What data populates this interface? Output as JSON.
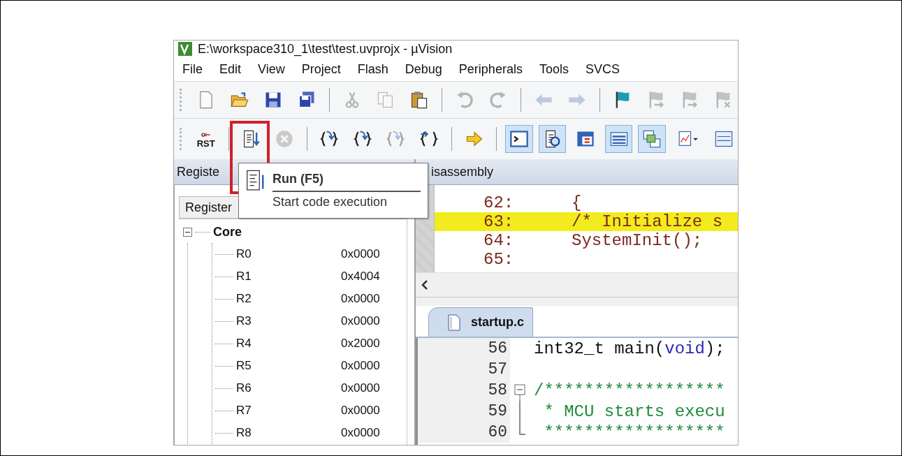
{
  "window": {
    "title": "E:\\workspace310_1\\test\\test.uvprojx - µVision"
  },
  "menu": [
    "File",
    "Edit",
    "View",
    "Project",
    "Flash",
    "Debug",
    "Peripherals",
    "Tools",
    "SVCS"
  ],
  "toolbar_file": [
    {
      "kind": "button",
      "disabled": false
    },
    {
      "kind": "button",
      "disabled": false
    },
    {
      "kind": "button",
      "disabled": false
    },
    {
      "kind": "button",
      "disabled": false
    },
    {
      "kind": "separator"
    },
    {
      "kind": "button",
      "disabled": true
    },
    {
      "kind": "button",
      "disabled": true
    },
    {
      "kind": "button",
      "disabled": false
    },
    {
      "kind": "separator"
    },
    {
      "kind": "button",
      "disabled": true
    },
    {
      "kind": "button",
      "disabled": true
    },
    {
      "kind": "separator"
    },
    {
      "kind": "button",
      "disabled": true
    },
    {
      "kind": "button",
      "disabled": true
    },
    {
      "kind": "separator"
    },
    {
      "kind": "button",
      "disabled": false
    },
    {
      "kind": "button",
      "disabled": true
    },
    {
      "kind": "button",
      "disabled": true
    },
    {
      "kind": "button",
      "disabled": true
    }
  ],
  "toolbar_debug": [
    {
      "kind": "text_button",
      "label": "RST",
      "disabled": false,
      "selected": false
    },
    {
      "kind": "separator"
    },
    {
      "kind": "button",
      "disabled": false,
      "selected": false
    },
    {
      "kind": "button",
      "disabled": true,
      "selected": false
    },
    {
      "kind": "separator"
    },
    {
      "kind": "button",
      "disabled": false,
      "selected": false
    },
    {
      "kind": "button",
      "disabled": false,
      "selected": false
    },
    {
      "kind": "button",
      "disabled": true,
      "selected": false
    },
    {
      "kind": "button",
      "disabled": false,
      "selected": false
    },
    {
      "kind": "separator"
    },
    {
      "kind": "button",
      "disabled": false,
      "selected": false
    },
    {
      "kind": "separator"
    },
    {
      "kind": "button",
      "disabled": false,
      "selected": true
    },
    {
      "kind": "button",
      "disabled": false,
      "selected": true
    },
    {
      "kind": "button",
      "disabled": false,
      "selected": false
    },
    {
      "kind": "button",
      "disabled": false,
      "selected": true
    },
    {
      "kind": "button",
      "disabled": false,
      "selected": true
    },
    {
      "kind": "button",
      "disabled": false,
      "selected": false
    },
    {
      "kind": "button",
      "disabled": false,
      "selected": false
    }
  ],
  "tooltip": {
    "title": "Run (F5)",
    "description": "Start code execution"
  },
  "registers_panel": {
    "header": "Registe",
    "tab": "Register",
    "tree": [
      {
        "name": "Core",
        "expanded": true,
        "children": [
          {
            "name": "R0",
            "value": "0x0000"
          },
          {
            "name": "R1",
            "value": "0x4004"
          },
          {
            "name": "R2",
            "value": "0x0000"
          },
          {
            "name": "R3",
            "value": "0x0000"
          },
          {
            "name": "R4",
            "value": "0x2000"
          },
          {
            "name": "R5",
            "value": "0x0000"
          },
          {
            "name": "R6",
            "value": "0x0000"
          },
          {
            "name": "R7",
            "value": "0x0000"
          },
          {
            "name": "R8",
            "value": "0x0000"
          }
        ]
      }
    ]
  },
  "disassembly": {
    "header": "isassembly",
    "lines": [
      {
        "number": "62:",
        "code": "{",
        "current": false
      },
      {
        "number": "63:",
        "code": "/* Initialize s",
        "current": true
      },
      {
        "number": "64:",
        "code": "SystemInit();",
        "current": false
      },
      {
        "number": "65:",
        "current": false
      }
    ]
  },
  "editor": {
    "tabs": [
      {
        "label": "startup.c",
        "selected": true
      }
    ],
    "lines": [
      {
        "number": "56",
        "kind": "plain",
        "tokens": [
          {
            "kind": "plain",
            "text": "int32_t main("
          },
          {
            "kind": "keyword",
            "text": "void"
          },
          {
            "kind": "plain",
            "text": ");"
          }
        ]
      },
      {
        "number": "57",
        "kind": "plain"
      },
      {
        "number": "58",
        "kind": "fold_start",
        "tokens": [
          {
            "kind": "comment",
            "text": "/******************"
          }
        ]
      },
      {
        "number": "59",
        "kind": "fold_inside",
        "tokens": [
          {
            "kind": "comment",
            "text": " * MCU starts execu"
          }
        ]
      },
      {
        "number": "60",
        "kind": "fold_end",
        "tokens": [
          {
            "kind": "comment",
            "text": " ******************"
          }
        ]
      }
    ]
  }
}
